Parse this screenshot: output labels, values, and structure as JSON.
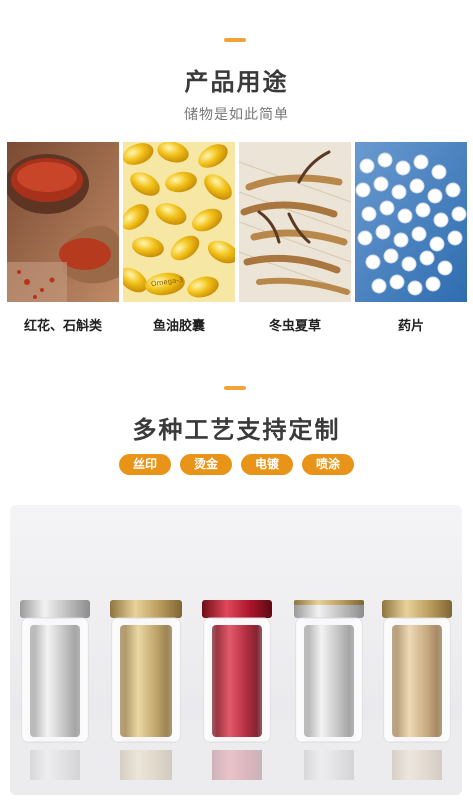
{
  "section1": {
    "title": "产品用途",
    "subtitle": "储物是如此简单",
    "items": [
      {
        "label": "红花、石斛类",
        "icon": "safflower-spoon-image"
      },
      {
        "label": "鱼油胶囊",
        "icon": "fish-oil-capsules-image"
      },
      {
        "label": "冬虫夏草",
        "icon": "cordyceps-image"
      },
      {
        "label": "药片",
        "icon": "white-pills-image"
      }
    ],
    "capsule_imprint": "Omega-3"
  },
  "section2": {
    "title": "多种工艺支持定制",
    "tags": [
      "丝印",
      "烫金",
      "电镀",
      "喷涂"
    ],
    "bottles": [
      {
        "name": "silver",
        "color": "#c9c9c9"
      },
      {
        "name": "gold",
        "color": "#c7aa6b"
      },
      {
        "name": "red",
        "color": "#b3162a"
      },
      {
        "name": "silver-gold-rim",
        "color": "#d0d0d4"
      },
      {
        "name": "champagne",
        "color": "#cfb184"
      }
    ]
  },
  "colors": {
    "accent": "#f2a33a",
    "tag": "#e79419",
    "title": "#3a3a3a"
  }
}
